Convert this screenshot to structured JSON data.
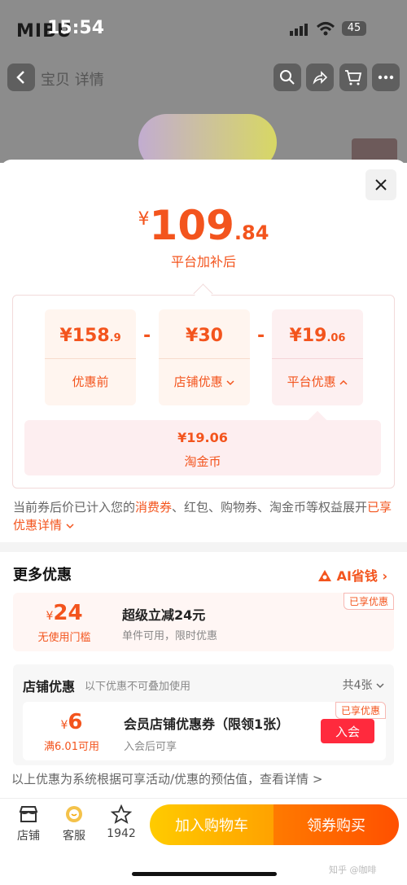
{
  "status": {
    "time": "15:54",
    "battery": "45",
    "brand": "MIBU"
  },
  "nav": {
    "title": "宝贝 详情"
  },
  "price": {
    "yen": "¥",
    "int": "109",
    "dec": ".84",
    "label": "平台加补后"
  },
  "breakdown": {
    "before": {
      "val": "¥158",
      "dec": ".9",
      "label": "优惠前"
    },
    "minus": "-",
    "store": {
      "val": "¥30",
      "label": "店铺优惠"
    },
    "platform": {
      "val": "¥19",
      "dec": ".06",
      "label": "平台优惠"
    },
    "coin": {
      "val": "¥19.06",
      "label": "淘金币"
    }
  },
  "note": {
    "p1": "当前券后价已计入您的",
    "p2": "消费券",
    "p3": "、红包、购物券、淘金币等权益展开",
    "p4": "已享优惠详情"
  },
  "more": {
    "title": "更多优惠",
    "ai": "AI省钱"
  },
  "promo": {
    "amount": "24",
    "yen": "¥",
    "cond": "无使用门槛",
    "title": "超级立减24元",
    "desc": "单件可用，限时优惠",
    "tag": "已享优惠"
  },
  "shop": {
    "title": "店铺优惠",
    "hint": "以下优惠不可叠加使用",
    "count": "共4张",
    "coupon": {
      "yen": "¥",
      "amount": "6",
      "cond": "满6.01可用",
      "title": "会员店铺优惠券（限领1张）",
      "desc": "入会后可享",
      "tag": "已享优惠",
      "button": "入会"
    }
  },
  "footnote": "以上优惠为系统根据可享活动/优惠的预估值，查看详情 >",
  "bottom": {
    "store": "店铺",
    "service": "客服",
    "fav": "1942",
    "cart": "加入购物车",
    "buy": "领券购买"
  },
  "watermark": "知乎 @咖啡"
}
